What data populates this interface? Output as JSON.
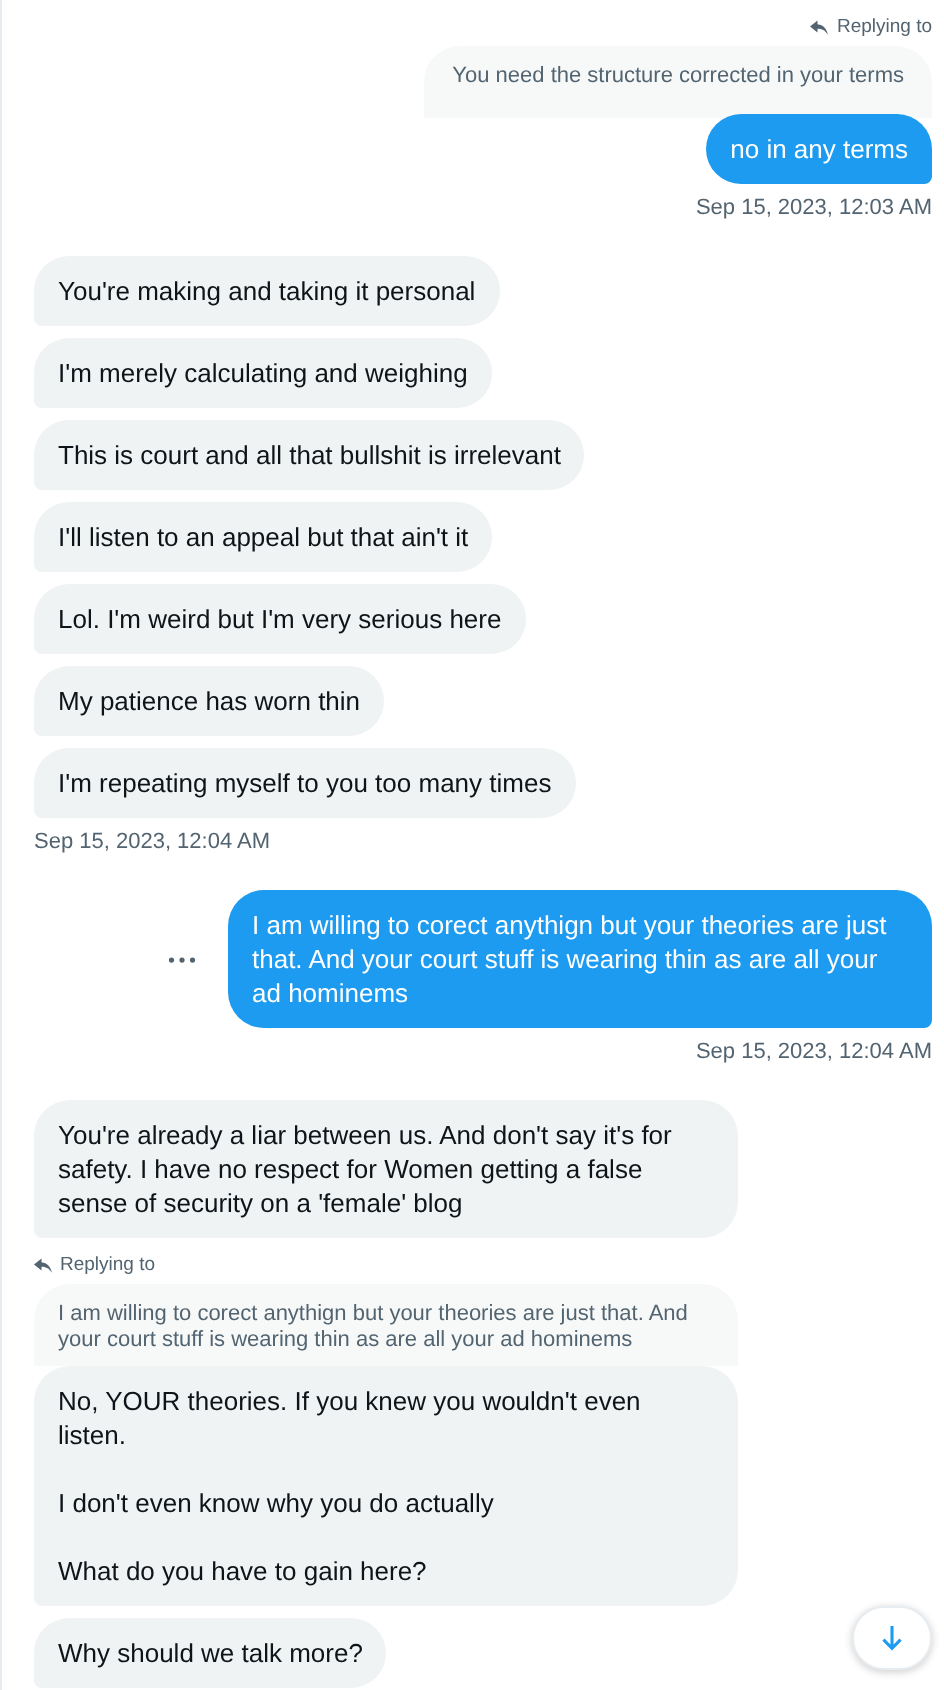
{
  "messages": [
    {
      "kind": "sent",
      "text": "no in any terms",
      "reply": {
        "label": "Replying to",
        "quote": "You need the structure corrected in your terms"
      }
    },
    {
      "kind": "timestamp",
      "text": "Sep 15, 2023, 12:03 AM"
    },
    {
      "kind": "received",
      "text": "You're making and taking it personal"
    },
    {
      "kind": "received",
      "text": "I'm merely calculating and weighing"
    },
    {
      "kind": "received",
      "text": "This is court and all that bullshit is irrelevant"
    },
    {
      "kind": "received",
      "text": "I'll listen to an appeal but that ain't it"
    },
    {
      "kind": "received",
      "text": "Lol. I'm weird but I'm very serious here"
    },
    {
      "kind": "received",
      "text": "My patience has worn thin"
    },
    {
      "kind": "received",
      "text": "I'm repeating myself to you too many times"
    },
    {
      "kind": "timestamp",
      "text": "Sep 15, 2023, 12:04 AM"
    },
    {
      "kind": "sent",
      "text": "I am willing to corect anythign but your theories are just that. And your court stuff is wearing thin as are all your ad hominems",
      "menu": true
    },
    {
      "kind": "timestamp",
      "text": "Sep 15, 2023, 12:04 AM"
    },
    {
      "kind": "received",
      "text": "You're already a liar between us. And don't say it's for safety.  I have no respect for Women getting a false sense of security on a 'female' blog"
    },
    {
      "kind": "received",
      "text": "No, YOUR theories. If you knew you wouldn't even listen.\n\nI don't even know why you do actually\n\nWhat do you have to gain here?",
      "reply": {
        "label": "Replying to",
        "quote": "I am willing to corect anythign but your theories are just that. And your court stuff is wearing thin as are all your ad hominems"
      }
    },
    {
      "kind": "received",
      "text": "Why should we talk more?"
    }
  ]
}
